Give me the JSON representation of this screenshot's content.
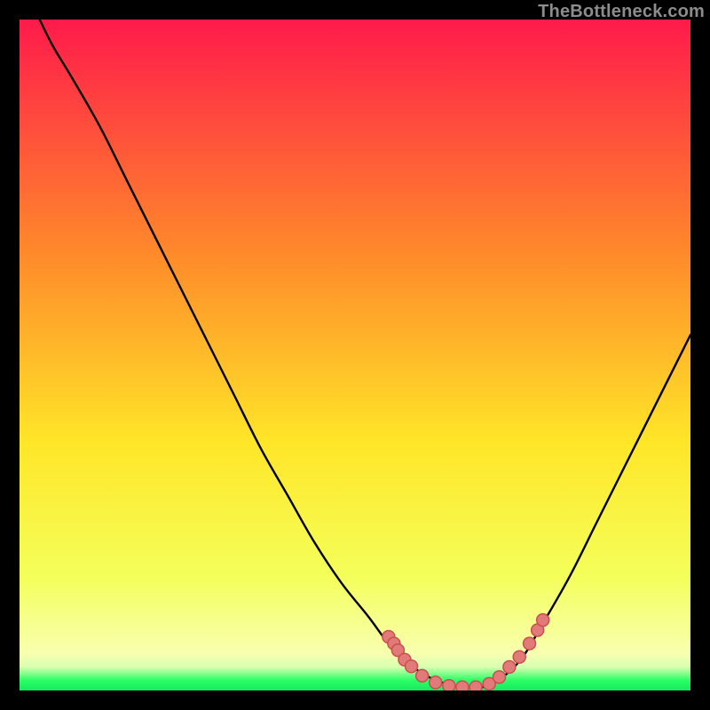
{
  "watermark": {
    "label": "TheBottleneck.com"
  },
  "colors": {
    "bg": "#000000",
    "grad_top": "#ff1a4b",
    "grad_mid1": "#ff8a2a",
    "grad_mid2": "#ffe628",
    "grad_mid3": "#f4ff5a",
    "grad_green": "#2aff66",
    "curve": "#000000",
    "dots_fill": "#e37a7a",
    "dots_stroke": "#c94f4f"
  },
  "chart_data": {
    "type": "line",
    "title": "",
    "xlabel": "",
    "ylabel": "",
    "xlim": [
      0,
      100
    ],
    "ylim": [
      0,
      100
    ],
    "series": [
      {
        "name": "bottleneck-curve",
        "x": [
          3,
          5,
          8,
          12,
          16,
          20,
          24,
          28,
          32,
          36,
          40,
          44,
          48,
          52,
          55,
          58,
          61,
          63.5,
          66,
          69,
          72,
          75,
          78,
          82,
          86,
          90,
          94,
          98,
          100
        ],
        "y": [
          100,
          96,
          91,
          84,
          76,
          68,
          60,
          52,
          44,
          36,
          29,
          22,
          16,
          11,
          7,
          4,
          2,
          1,
          0.5,
          0.5,
          2,
          5,
          10,
          17,
          25,
          33,
          41,
          49,
          53
        ]
      }
    ],
    "annotations": {
      "name": "highlighted-data-points",
      "points_xy": [
        [
          55.0,
          8.0
        ],
        [
          55.8,
          7.0
        ],
        [
          56.4,
          6.0
        ],
        [
          57.4,
          4.6
        ],
        [
          58.4,
          3.6
        ],
        [
          60.0,
          2.2
        ],
        [
          62.0,
          1.2
        ],
        [
          64.0,
          0.7
        ],
        [
          66.0,
          0.5
        ],
        [
          68.0,
          0.5
        ],
        [
          70.0,
          1.0
        ],
        [
          71.5,
          2.0
        ],
        [
          73.0,
          3.5
        ],
        [
          74.5,
          5.0
        ],
        [
          76.0,
          7.0
        ],
        [
          77.2,
          9.0
        ],
        [
          78.0,
          10.5
        ]
      ]
    }
  }
}
